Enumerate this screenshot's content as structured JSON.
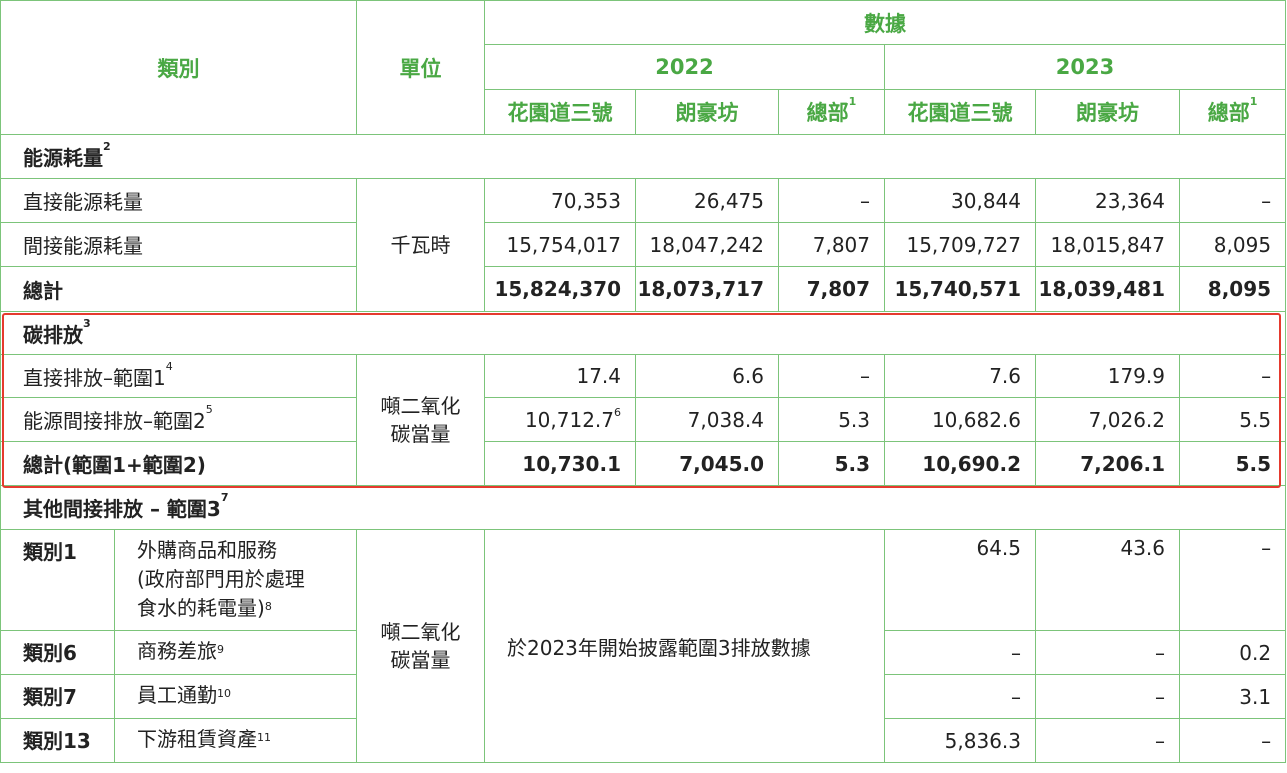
{
  "header": {
    "category": "類別",
    "unit": "單位",
    "data": "數據",
    "years": [
      "2022",
      "2023"
    ],
    "sites": [
      "花園道三號",
      "朗豪坊",
      "總部"
    ],
    "hq_note": "1"
  },
  "energy": {
    "title": "能源耗量",
    "note": "2",
    "unit": "千瓦時",
    "rows": [
      {
        "label": "直接能源耗量",
        "values": [
          "70,353",
          "26,475",
          "–",
          "30,844",
          "23,364",
          "–"
        ]
      },
      {
        "label": "間接能源耗量",
        "values": [
          "15,754,017",
          "18,047,242",
          "7,807",
          "15,709,727",
          "18,015,847",
          "8,095"
        ]
      },
      {
        "label": "總計",
        "values": [
          "15,824,370",
          "18,073,717",
          "7,807",
          "15,740,571",
          "18,039,481",
          "8,095"
        ]
      }
    ]
  },
  "carbon": {
    "title": "碳排放",
    "note": "3",
    "unit_line1": "噸二氧化",
    "unit_line2": "碳當量",
    "rows": [
      {
        "label": "直接排放–範圍1",
        "note": "4",
        "values": [
          "17.4",
          "6.6",
          "–",
          "7.6",
          "179.9",
          "–"
        ]
      },
      {
        "label": "能源間接排放–範圍2",
        "note": "5",
        "values": [
          "10,712.7",
          "7,038.4",
          "5.3",
          "10,682.6",
          "7,026.2",
          "5.5"
        ],
        "first_value_note": "6"
      },
      {
        "label": "總計(範圍1+範圍2)",
        "values": [
          "10,730.1",
          "7,045.0",
          "5.3",
          "10,690.2",
          "7,206.1",
          "5.5"
        ]
      }
    ]
  },
  "scope3": {
    "title": "其他間接排放 – 範圍3",
    "note": "7",
    "unit_line1": "噸二氧化",
    "unit_line2": "碳當量",
    "note_2022": "於2023年開始披露範圍3排放數據",
    "rows": [
      {
        "category": "類別1",
        "desc_line1": "外購商品和服務",
        "desc_line2": "(政府部門用於處理",
        "desc_line3": "食水的耗電量)",
        "note": "8",
        "values": [
          "64.5",
          "43.6",
          "–"
        ]
      },
      {
        "category": "類別6",
        "desc_line1": "商務差旅",
        "note": "9",
        "values": [
          "–",
          "–",
          "0.2"
        ]
      },
      {
        "category": "類別7",
        "desc_line1": "員工通勤",
        "note": "10",
        "values": [
          "–",
          "–",
          "3.1"
        ]
      },
      {
        "category": "類別13",
        "desc_line1": "下游租賃資產",
        "note": "11",
        "values": [
          "5,836.3",
          "–",
          "–"
        ]
      }
    ]
  },
  "colors": {
    "accent": "#4aa844",
    "border": "#7cc47a",
    "highlight": "#e53a2e"
  }
}
